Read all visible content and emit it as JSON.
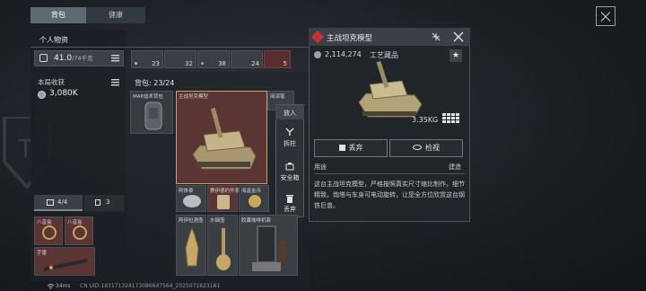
{
  "tabs": [
    {
      "label": "背包",
      "active": true
    },
    {
      "label": "健康",
      "active": false
    }
  ],
  "personal": {
    "title": "个人物资",
    "weight_value": "41.0",
    "weight_unit": "/74千克",
    "income_label": "本局收获",
    "income_value": "3,080K"
  },
  "slots": [
    {
      "count": "23"
    },
    {
      "count": "32"
    },
    {
      "count": "38"
    },
    {
      "count": "24"
    },
    {
      "count": "5"
    }
  ],
  "backpack": {
    "title": "背包: 23/24",
    "items": [
      {
        "label": "MAP战术背包"
      },
      {
        "label": "主战坦克模型"
      },
      {
        "label": "阿体泰"
      },
      {
        "label": "赛伊德的怀表"
      },
      {
        "label": "海盗金币"
      },
      {
        "label": "阿伊拉酒壶"
      },
      {
        "label": "水烟壶"
      },
      {
        "label": "胶囊咖啡机套"
      },
      {
        "label": "阅读笔"
      }
    ]
  },
  "left_tabs": {
    "tab1": "4/4",
    "tab2": "3"
  },
  "left_items": [
    {
      "label": "八音盒"
    },
    {
      "label": "八音盒"
    },
    {
      "label": "手雷"
    }
  ],
  "context_menu": [
    {
      "label": "放入"
    },
    {
      "label": "拆柱"
    },
    {
      "label": "安全箱"
    },
    {
      "label": "丢弃"
    }
  ],
  "detail": {
    "title": "主战坦克模型",
    "price": "2,114,274",
    "category": "工艺藏品",
    "weight": "3.35KG",
    "discard_label": "丢弃",
    "inspect_label": "检视",
    "usage_label": "用途",
    "usage_value": "建造",
    "description": "这台主战坦克模型，严格按照真实尺寸缩比制作，细节精致。炮塔与车身可电动旋转，让您全方位欣赏这台钢铁巨兽。"
  },
  "status": {
    "ping": "34ms",
    "uid": "CN UID:183171324173086647564_2025071823181"
  },
  "colors": {
    "accent_red": "#c8313a",
    "selected_border": "#c9a06a",
    "weight_purple": "#c9b8ff"
  },
  "icons": [
    "bag-icon",
    "weight-icon",
    "coin-icon",
    "tank-icon",
    "close-icon",
    "collapse-icon",
    "star-icon",
    "trash-icon",
    "eye-icon",
    "wifi-icon",
    "menu-icon",
    "lock-icon"
  ]
}
